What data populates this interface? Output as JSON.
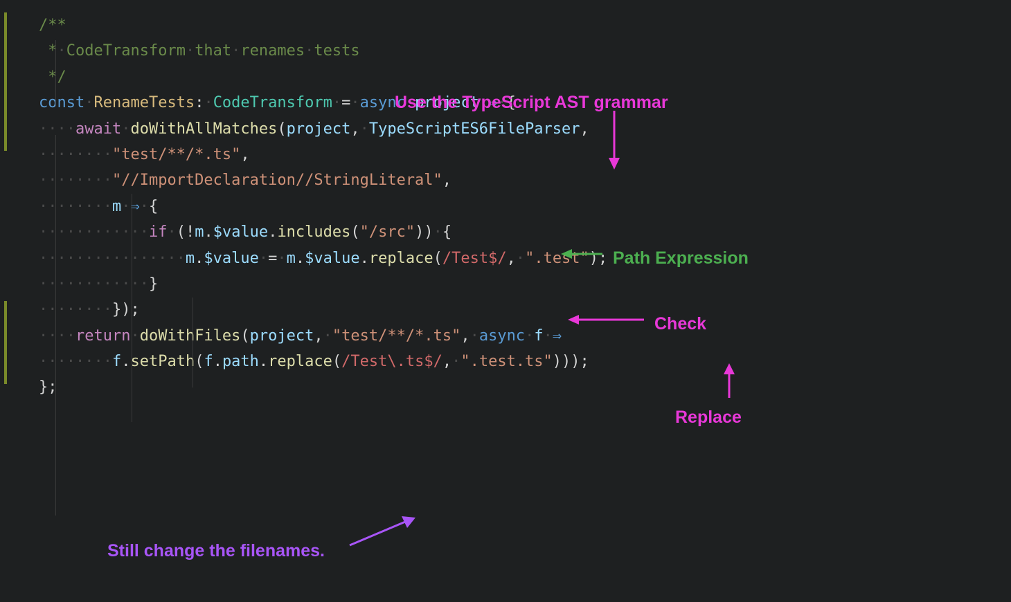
{
  "code": {
    "comment_open": "/**",
    "comment_body": " * CodeTransform that renames tests",
    "comment_close": " */",
    "l1_const": "const",
    "l1_name": "RenameTests",
    "l1_colon": ":",
    "l1_type": "CodeTransform",
    "l1_eq": "=",
    "l1_async": "async",
    "l1_param": "project",
    "l1_arrow": "⇒",
    "l1_brace": "{",
    "l2_await": "await",
    "l2_fn": "doWithAllMatches",
    "l2_p1": "project",
    "l2_p2": "TypeScriptES6FileParser",
    "l3_str": "\"test/**/*.ts\"",
    "l4_str": "\"//ImportDeclaration//StringLiteral\"",
    "l5_m": "m",
    "l5_arrow": "⇒",
    "l5_brace": "{",
    "l6_if": "if",
    "l6_not": "!",
    "l6_m": "m",
    "l6_dot": ".",
    "l6_val": "$value",
    "l6_inc": "includes",
    "l6_arg": "\"/src\"",
    "l6_brace": "{",
    "l7_m": "m",
    "l7_val": "$value",
    "l7_eq": "=",
    "l7_m2": "m",
    "l7_val2": "$value",
    "l7_rep": "replace",
    "l7_regex": "/Test$/",
    "l7_repstr": "\".test\"",
    "l8_brace": "}",
    "l9_close": "});",
    "l10_return": "return",
    "l10_fn": "doWithFiles",
    "l10_p1": "project",
    "l10_str": "\"test/**/*.ts\"",
    "l10_async": "async",
    "l10_f": "f",
    "l10_arrow": "⇒",
    "l11_f": "f",
    "l11_set": "setPath",
    "l11_f2": "f",
    "l11_path": "path",
    "l11_rep": "replace",
    "l11_regex": "/Test\\.ts$/",
    "l11_str": "\".test.ts\"",
    "l12_close": "};"
  },
  "annotations": {
    "ast": "Use the TypeScript AST grammar",
    "path": "Path Expression",
    "check": "Check",
    "replace": "Replace",
    "filenames": "Still change the filenames."
  },
  "dots": {
    "d4": "····",
    "d8": "········",
    "d12": "············",
    "d16": "················"
  }
}
